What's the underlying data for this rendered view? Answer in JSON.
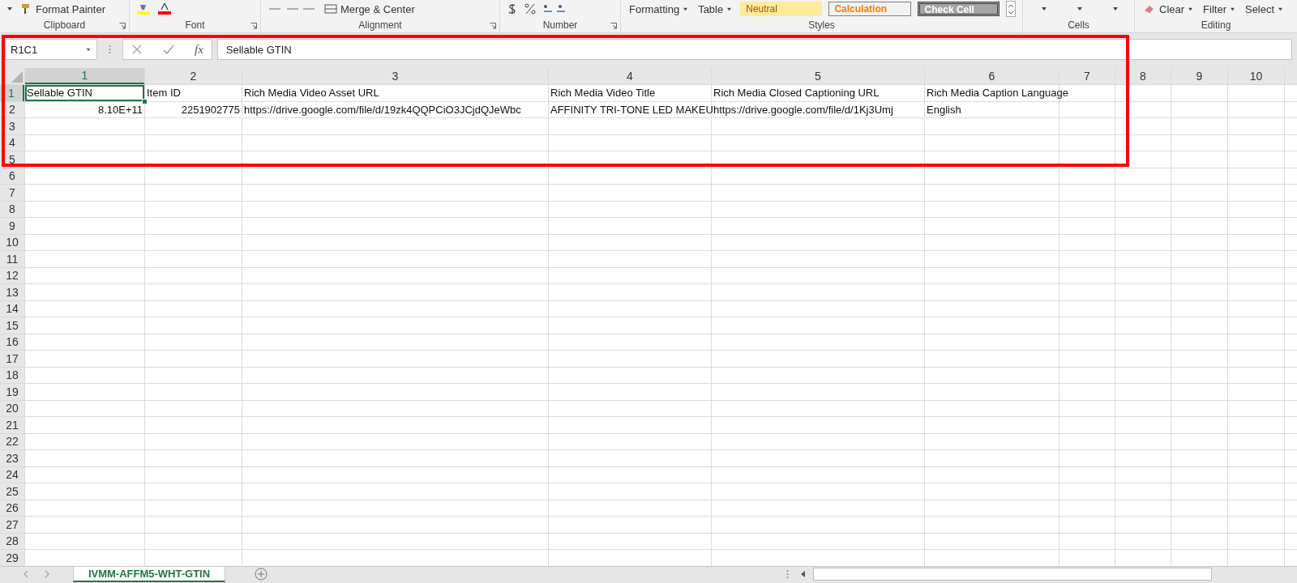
{
  "ribbon": {
    "groups": [
      {
        "kind": "clipboard",
        "label": "Clipboard",
        "items": [
          {
            "kind": "painter",
            "text": "Format Painter"
          }
        ]
      },
      {
        "kind": "font",
        "label": "Font"
      },
      {
        "kind": "alignment",
        "label": "Alignment",
        "items": [
          {
            "kind": "merge",
            "text": "Merge & Center"
          }
        ]
      },
      {
        "kind": "number",
        "label": "Number"
      },
      {
        "kind": "styles",
        "label": "Styles",
        "items": [
          {
            "kind": "dropdown",
            "text": "Formatting"
          },
          {
            "kind": "dropdown",
            "text": "Table"
          },
          {
            "kind": "neutral",
            "text": "Neutral"
          },
          {
            "kind": "calculation",
            "text": "Calculation"
          },
          {
            "kind": "check",
            "text": "Check Cell"
          }
        ]
      },
      {
        "kind": "cells",
        "label": "Cells"
      },
      {
        "kind": "editing",
        "label": "Editing",
        "items": [
          {
            "kind": "clear",
            "text": "Clear"
          },
          {
            "kind": "dropdown",
            "text": "Filter"
          },
          {
            "kind": "dropdown",
            "text": "Select"
          }
        ]
      }
    ]
  },
  "formula_bar": {
    "name_box": "R1C1",
    "fx": "fx",
    "value": "Sellable GTIN"
  },
  "sheet": {
    "columns": [
      {
        "label": "1",
        "selected": true
      },
      {
        "label": "2",
        "selected": false
      },
      {
        "label": "3",
        "selected": false
      },
      {
        "label": "4",
        "selected": false
      },
      {
        "label": "5",
        "selected": false
      },
      {
        "label": "6",
        "selected": false
      },
      {
        "label": "7",
        "selected": false
      },
      {
        "label": "8",
        "selected": false
      },
      {
        "label": "9",
        "selected": false
      },
      {
        "label": "10",
        "selected": false
      }
    ],
    "rows": [
      {
        "label": "1",
        "selected": true,
        "cells": [
          {
            "kind": "text",
            "text": "Sellable GTIN"
          },
          {
            "kind": "text",
            "text": "Item ID"
          },
          {
            "kind": "text",
            "text": "Rich Media Video Asset URL"
          },
          {
            "kind": "text",
            "text": "Rich Media Video Title"
          },
          {
            "kind": "text",
            "text": "Rich Media Closed Captioning URL"
          },
          {
            "kind": "text",
            "text": "Rich Media Caption Language"
          }
        ]
      },
      {
        "label": "2",
        "selected": false,
        "cells": [
          {
            "kind": "number",
            "text": "8.10E+11"
          },
          {
            "kind": "number",
            "text": "2251902775"
          },
          {
            "kind": "text",
            "text": "https://drive.google.com/file/d/19zk4QQPCiO3JCjdQJeWbc"
          },
          {
            "kind": "text",
            "text": "AFFINITY TRI-TONE LED MAKEU"
          },
          {
            "kind": "text",
            "text": "https://drive.google.com/file/d/1Kj3Umj"
          },
          {
            "kind": "text",
            "text": "English"
          }
        ]
      },
      {
        "label": "3",
        "selected": false
      },
      {
        "label": "4",
        "selected": false
      },
      {
        "label": "5",
        "selected": false
      },
      {
        "label": "6",
        "selected": false
      },
      {
        "label": "7",
        "selected": false
      },
      {
        "label": "8",
        "selected": false
      },
      {
        "label": "9",
        "selected": false
      },
      {
        "label": "10",
        "selected": false
      },
      {
        "label": "11",
        "selected": false
      },
      {
        "label": "12",
        "selected": false
      },
      {
        "label": "13",
        "selected": false
      },
      {
        "label": "14",
        "selected": false
      },
      {
        "label": "15",
        "selected": false
      },
      {
        "label": "16",
        "selected": false
      },
      {
        "label": "17",
        "selected": false
      },
      {
        "label": "18",
        "selected": false
      },
      {
        "label": "19",
        "selected": false
      },
      {
        "label": "20",
        "selected": false
      },
      {
        "label": "21",
        "selected": false
      },
      {
        "label": "22",
        "selected": false
      },
      {
        "label": "23",
        "selected": false
      },
      {
        "label": "24",
        "selected": false
      },
      {
        "label": "25",
        "selected": false
      },
      {
        "label": "26",
        "selected": false
      },
      {
        "label": "27",
        "selected": false
      },
      {
        "label": "28",
        "selected": false
      },
      {
        "label": "29",
        "selected": false
      }
    ]
  },
  "sheet_tabs": [
    {
      "label": "IVMM-AFFM5-WHT-GTIN",
      "selected": true
    }
  ]
}
